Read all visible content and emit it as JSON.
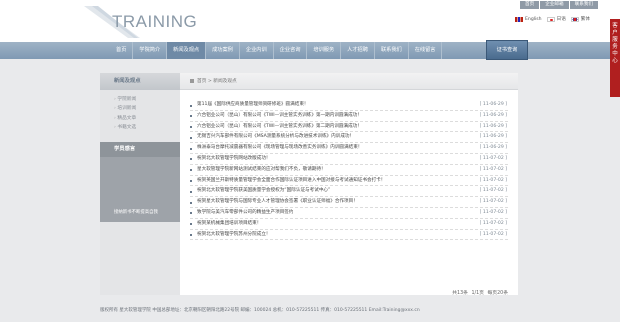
{
  "header": {
    "brand": "TRAINING",
    "toplinks": [
      "首页",
      "企业邮箱",
      "联系我们"
    ],
    "languages": [
      {
        "flag": "uk",
        "label": "English"
      },
      {
        "flag": "jp",
        "label": "日语"
      },
      {
        "flag": "kr",
        "label": "繁体"
      }
    ]
  },
  "nav": {
    "items": [
      "首页",
      "学院简介",
      "新闻及观点",
      "成功案例",
      "企业内训",
      "企业咨询",
      "培训服务",
      "人才招聘",
      "联系我们",
      "在线留言"
    ],
    "cta": "证书查询"
  },
  "sidebar": {
    "title": "新闻及观点",
    "items": [
      "学院新闻",
      "培训新闻",
      "精品文章",
      "书籍文选"
    ],
    "block_title": "学员感言",
    "block_footer": "接纳新书不断提高自我"
  },
  "breadcrumb": "首页 > 新闻及观点",
  "news": [
    {
      "title": "第11届《国际供应商质量管理师资研修班》圆满结束！",
      "date": "[ 11-06-29 ]"
    },
    {
      "title": "六合铝业公司（昆山）有限公司《TWI—训主管实务训练》第一期内训圆满成功！",
      "date": "[ 11-06-29 ]"
    },
    {
      "title": "六合铝业公司（昆山）有限公司《TWI—训主管实务训练》第二期内训圆满成功！",
      "date": "[ 11-06-29 ]"
    },
    {
      "title": "无锡吉兴汽车部件有限公司《MSA测量系统分析与改进技术训练》内训成功！",
      "date": "[ 11-06-29 ]"
    },
    {
      "title": "株洲泰马台摩托减震器有限公司《现场管理与现场改善实务训练》内训圆满结束！",
      "date": "[ 11-06-29 ]"
    },
    {
      "title": "祝贺北大软管理学院网站改版成功！",
      "date": "[ 11-07-02 ]"
    },
    {
      "title": "星大软管理学院新网站测试结束的应对帮我们不负，敬请期待！",
      "date": "[ 11-07-02 ]"
    },
    {
      "title": "祝贺英国兰开斯特质量管理学会全面合作国际认证项目进入中国对接与考试通知证书会打卡！",
      "date": "[ 11-07-02 ]"
    },
    {
      "title": "祝贺北大软管理学院获美国质量学会授权为“国际认证与考试中心”",
      "date": "[ 11-07-02 ]"
    },
    {
      "title": "祝贺星大软管理学院与国际专业人才管理协会签署《职业认证师福》合作项目！",
      "date": "[ 11-07-02 ]"
    },
    {
      "title": "致学院与美汽车零部件公司的精益生产项目签约",
      "date": "[ 11-07-02 ]"
    },
    {
      "title": "祝贺某机械集团培训项目结束！",
      "date": "[ 11-07-02 ]"
    },
    {
      "title": "祝贺北大软管理学院苏州分院成立！",
      "date": "[ 11-07-02 ]"
    }
  ],
  "pager": "共13条 1/1页 每页20条",
  "footer": "版权所有 星大软管理学院 中国总部地址：北京朝阳区朝阳北路22号院 邮编：100024 总机：010-57225511 传真：010-57225511 Email:Training@xxx.cn",
  "float_tab": "客户服务中心",
  "colors": {
    "nav": "#8aa3bb",
    "cta": "#4a6b8e",
    "float_tab": "#b01f1f"
  }
}
